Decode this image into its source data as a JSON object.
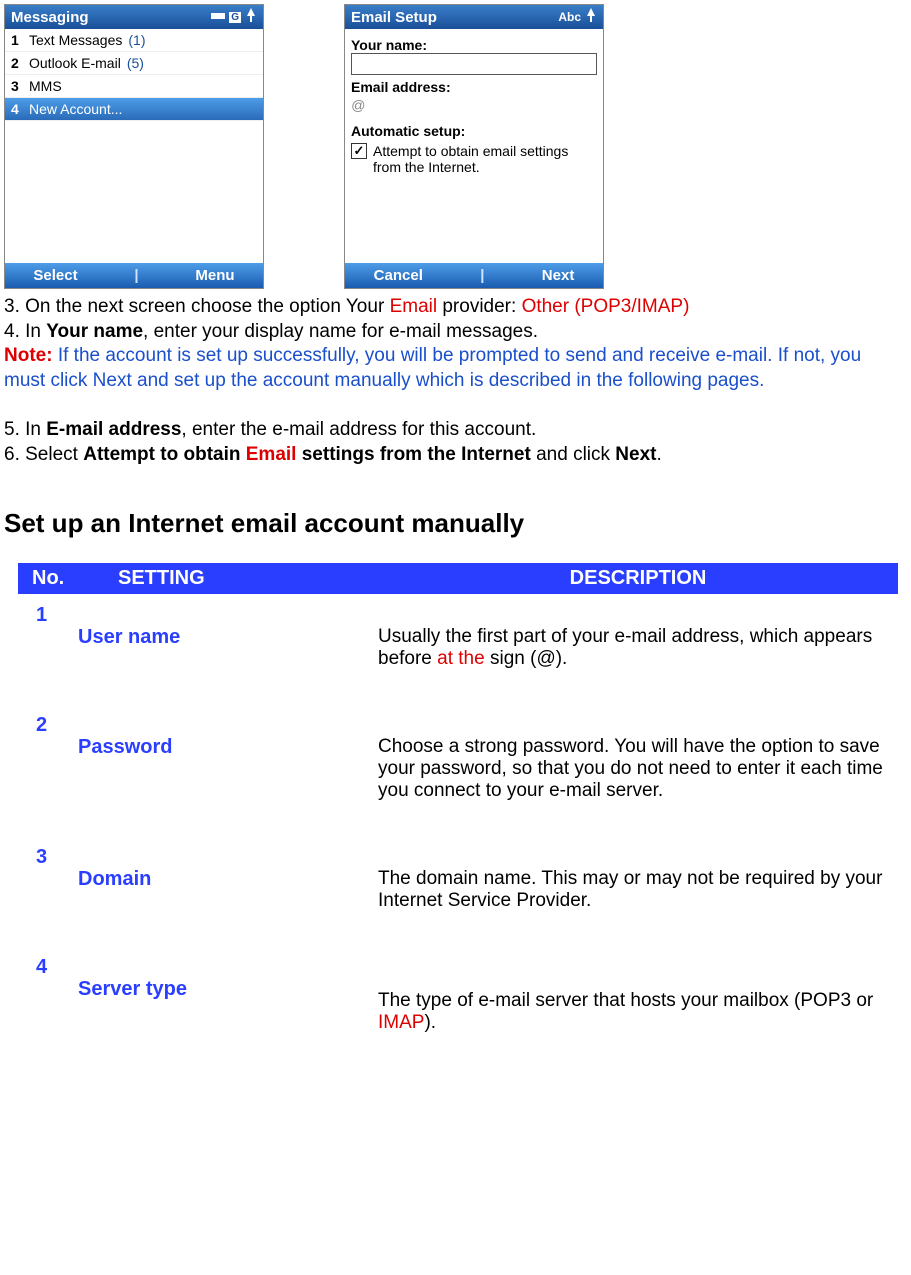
{
  "phone_left": {
    "title": "Messaging",
    "items": [
      {
        "num": "1",
        "label": "Text Messages",
        "count": "(1)"
      },
      {
        "num": "2",
        "label": "Outlook E-mail",
        "count": "(5)"
      },
      {
        "num": "3",
        "label": "MMS",
        "count": ""
      },
      {
        "num": "4",
        "label": "New Account...",
        "count": ""
      }
    ],
    "soft_left": "Select",
    "soft_right": "Menu"
  },
  "phone_right": {
    "title": "Email Setup",
    "status": "Abc",
    "label_name": "Your name:",
    "label_email": "Email address:",
    "email_placeholder": "@",
    "label_auto": "Automatic setup:",
    "checkbox_text": "Attempt to obtain email settings from the Internet.",
    "soft_left": "Cancel",
    "soft_right": "Next"
  },
  "instr": {
    "l1a": "3. On the next screen choose the option Your ",
    "l1b": "Email",
    "l1c": " provider: ",
    "l1d": "Other (POP3/IMAP)",
    "l2a": "4. In ",
    "l2b": "Your name",
    "l2c": ", enter your display name for e-mail messages.",
    "noteLabel": "Note:",
    "noteBody": " If the account is set up successfully, you will be prompted to send and receive e-mail. If not, you must click Next and set up the account manually which is described in the following pages.",
    "l5a": "5. In ",
    "l5b": "E-mail address",
    "l5c": ", enter the e-mail address for this account.",
    "l6a": "6. Select ",
    "l6b": "Attempt to obtain ",
    "l6c": "Email",
    "l6d": " settings from the Internet",
    "l6e": " and click ",
    "l6f": "Next",
    "l6g": "."
  },
  "section_heading": "Set up an Internet email account manually",
  "table": {
    "head_no": "No.",
    "head_setting": "SETTING",
    "head_desc": "DESCRIPTION",
    "rows": [
      {
        "no": "1",
        "setting": "User name",
        "desc_a": "Usually the first part of your e-mail address, which appears before ",
        "desc_red": "at the",
        "desc_b": " sign (@)."
      },
      {
        "no": "2",
        "setting": "Password",
        "desc_a": "Choose a strong password. You will have the option to save your password, so that you do not need to enter it each time you connect to your e-mail server.",
        "desc_red": "",
        "desc_b": ""
      },
      {
        "no": "3",
        "setting": "Domain",
        "desc_a": "The domain name. This may or may not be required by your Internet Service Provider.",
        "desc_red": "",
        "desc_b": ""
      },
      {
        "no": "4",
        "setting": "Server type",
        "desc_a": "The type of e-mail server that hosts your mailbox (POP3 or ",
        "desc_red": "IMAP",
        "desc_b": ")."
      }
    ]
  }
}
